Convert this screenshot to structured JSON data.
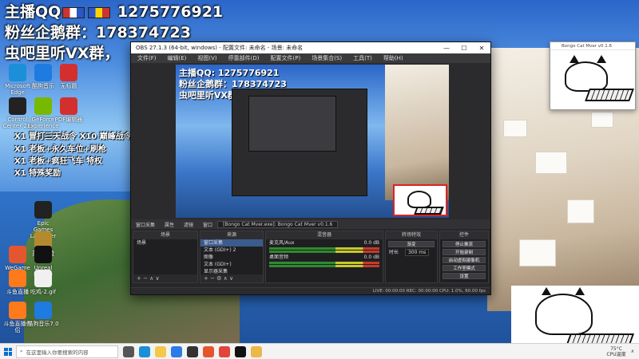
{
  "overlay": {
    "line1": "主播QQ",
    "line1_number": "1275776921",
    "line2": "粉丝企鹅群：178374723",
    "line3": "虫吧里听VX群，"
  },
  "desktop_icons": [
    {
      "label": "Microsoft Edge",
      "color": "#1b8fd8"
    },
    {
      "label": "酷狗音乐",
      "color": "#1e7be0"
    },
    {
      "label": "无标题",
      "color": "#d32f2f"
    },
    {
      "label": "Control Center 2.0",
      "color": "#222222"
    },
    {
      "label": "GeForce Experience",
      "color": "#76b900"
    },
    {
      "label": "PDF编辑器",
      "color": "#d32f2f"
    },
    {
      "label": "Epic Games Launcher",
      "color": "#222222"
    },
    {
      "label": "英雄联盟",
      "color": "#b58a2e"
    },
    {
      "label": "WeGame",
      "color": "#e4572e"
    },
    {
      "label": "Unreal Engine",
      "color": "#111111"
    },
    {
      "label": "斗鱼直播",
      "color": "#ff7a1a"
    },
    {
      "label": "吃鸡-2.gif",
      "color": "#f0f0f0"
    },
    {
      "label": "斗鱼直播伴侣",
      "color": "#ff7a1a"
    },
    {
      "label": "酷狗音乐7.0",
      "color": "#1e7be0"
    }
  ],
  "activities": [
    "X1 冒打三天战令 X10 巅峰战令",
    "X1 老板+永久车位+刷枪",
    "X1 老板+疯狂飞车 特权",
    "X1 特殊奖励"
  ],
  "obs": {
    "title": "OBS 27.1.3 (64-bit, windows) - 配置文件: 未命名 - 场景: 未命名",
    "menu": [
      "文件(F)",
      "编辑(E)",
      "视图(V)",
      "停靠部件(D)",
      "配置文件(P)",
      "场景集合(S)",
      "工具(T)",
      "帮助(H)"
    ],
    "preview_text": {
      "line1": "主播QQ: 1275776921",
      "line2": "粉丝企鹅群：178374723",
      "line3": "虫吧里听VX群"
    },
    "dock_tabs": [
      "窗口采集",
      "属性",
      "滤镜",
      "窗口",
      "[Bongo Cat Mver.exe]: Bongo Cat Mver v0.1.6"
    ],
    "scenes": {
      "header": "场景",
      "items": [
        "场景"
      ]
    },
    "sources": {
      "header": "来源",
      "items": [
        "窗口采集",
        "文本 (GDI+) 2",
        "图像",
        "文本 (GDI+)",
        "显示器采集"
      ]
    },
    "mixer": {
      "header": "混音器",
      "channels": [
        {
          "name": "麦克风/Aux",
          "db": "0.0 dB"
        },
        {
          "name": "桌面音频",
          "db": "0.0 dB"
        }
      ]
    },
    "transitions": {
      "header": "转场特效",
      "type": "渐变",
      "duration_label": "时长",
      "duration": "300 ms"
    },
    "controls": {
      "header": "控件",
      "buttons": [
        "停止推流",
        "开始录制",
        "启动虚拟摄像机",
        "工作室模式",
        "设置",
        "退出"
      ]
    },
    "status": "LIVE: 00:00:00   REC: 00:00:00   CPU: 1.0%, 60.00 fps"
  },
  "bongo": {
    "title": "Bongo Cat Mver v0.1.6"
  },
  "taskbar": {
    "search_placeholder": "在这里输入你要搜索的内容",
    "apps": [
      {
        "name": "task-view",
        "color": "#555555"
      },
      {
        "name": "edge",
        "color": "#1b8fd8"
      },
      {
        "name": "file-explorer",
        "color": "#f2c94c"
      },
      {
        "name": "store",
        "color": "#2d7be5"
      },
      {
        "name": "obs",
        "color": "#333333"
      },
      {
        "name": "wegame",
        "color": "#e4572e"
      },
      {
        "name": "chrome",
        "color": "#e0463a"
      },
      {
        "name": "qq",
        "color": "#111111"
      },
      {
        "name": "bongo-cat",
        "color": "#e9b949"
      }
    ],
    "weather_temp": "75°C",
    "weather_label": "CPU温度"
  }
}
